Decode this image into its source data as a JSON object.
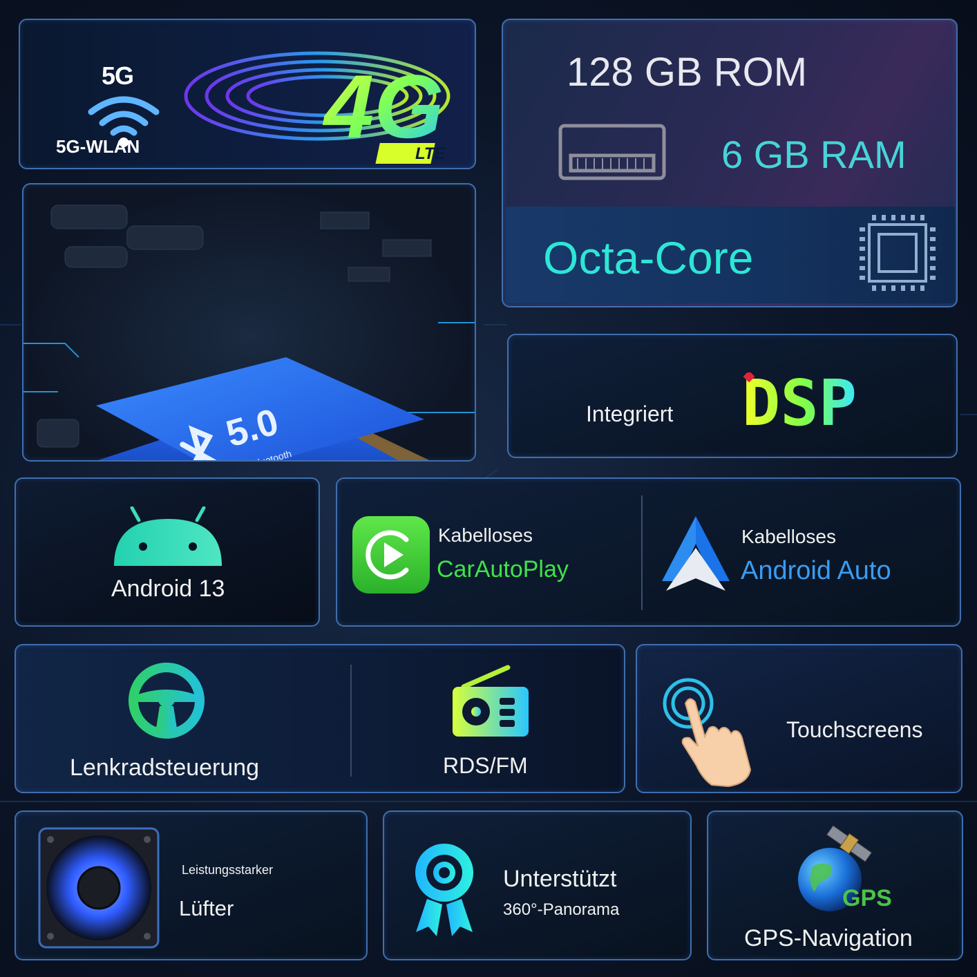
{
  "network": {
    "wifi_badge": "5G",
    "wifi_label": "5G-WLAN",
    "cellular_logo": "4G",
    "cellular_sub": "LTE",
    "icons": [
      "wifi-icon",
      "4g-lte-logo"
    ]
  },
  "memory": {
    "rom": "128 GB ROM",
    "ram": "6 GB RAM",
    "cpu": "Octa-Core",
    "icons": [
      "ram-chip-icon",
      "cpu-icon"
    ]
  },
  "bluetooth": {
    "version": "5.0",
    "caption": "Bluetooth"
  },
  "dsp": {
    "label": "Integriert",
    "logo": "DSP"
  },
  "android": {
    "label": "Android 13"
  },
  "carplay": {
    "prefix": "Kabelloses",
    "name": "CarAutoPlay"
  },
  "android_auto": {
    "prefix": "Kabelloses",
    "name": "Android Auto"
  },
  "steering": {
    "label": "Lenkradsteuerung"
  },
  "radio": {
    "label": "RDS/FM"
  },
  "touch": {
    "label": "Touchscreens"
  },
  "fan": {
    "small": "Leistungsstarker",
    "big": "Lüfter"
  },
  "panorama": {
    "big": "Unterstützt",
    "small": "360°-Panorama"
  },
  "gps": {
    "logo": "GPS",
    "label": "GPS-Navigation"
  },
  "colors": {
    "accent_cyan": "#2ee6d6",
    "carplay_green": "#3fe24a",
    "android_auto_blue": "#3a9cf2",
    "panel_border": "#3f6fae",
    "background": "#0c1629"
  }
}
